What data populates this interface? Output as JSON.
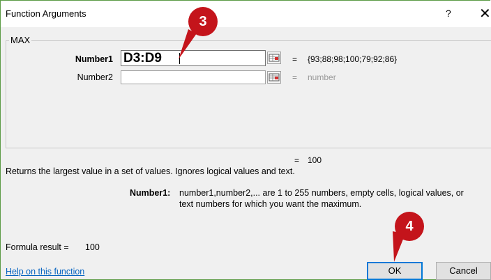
{
  "dialog": {
    "title": "Function Arguments",
    "help_glyph": "?",
    "close_glyph": "✕",
    "function_name": "MAX"
  },
  "args": [
    {
      "label": "Number1",
      "value": "D3:D9",
      "eq": "=",
      "result": "{93;88;98;100;79;92;86}"
    },
    {
      "label": "Number2",
      "value": "",
      "eq": "=",
      "result": "number"
    }
  ],
  "result_line": {
    "eq": "=",
    "value": "100"
  },
  "description": "Returns the largest value in a set of values. Ignores logical values and text.",
  "arg_help": {
    "label": "Number1:",
    "text_line1": "number1,number2,... are 1 to 255 numbers, empty cells, logical values, or",
    "text_line2": "text numbers for which you want the maximum."
  },
  "formula_result": {
    "label": "Formula result =",
    "value": "100"
  },
  "help_link": "Help on this function",
  "buttons": {
    "ok": "OK",
    "cancel": "Cancel"
  },
  "callouts": {
    "step3": "3",
    "step4": "4"
  },
  "colors": {
    "callout": "#c4141b",
    "link": "#0563c1",
    "frame": "#5b9b45"
  }
}
